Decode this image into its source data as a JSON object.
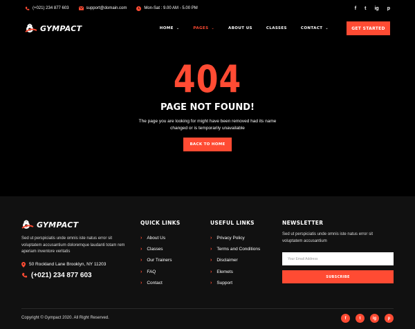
{
  "topbar": {
    "phone": "(+021) 234 877 603",
    "email": "support@domain.com",
    "hours": "Mon-Sat : 9.00 AM - 5.00 PM",
    "socials": [
      "f",
      "t",
      "ig",
      "p"
    ]
  },
  "brand": {
    "name": "GYMPACT",
    "accent_color": "#ff4b33"
  },
  "nav": {
    "items": [
      {
        "label": "HOME",
        "chevron": "⌄"
      },
      {
        "label": "PAGES",
        "chevron": "⌄"
      },
      {
        "label": "ABOUT US"
      },
      {
        "label": "CLASSES"
      },
      {
        "label": "CONTACT",
        "chevron": "⌄"
      }
    ],
    "cta": "GET STARTED"
  },
  "error": {
    "code": "404",
    "title": "PAGE NOT FOUND!",
    "message": "The page you are looking for might have been removed had its name changed or is temporarily unavailable",
    "button": "BACK TO HOME"
  },
  "footer": {
    "about": {
      "description": "Sed ut perspiciatis unde omnis iste natus error sit voluptatem accusantium doloremque laudanti totam rem aperiam inventore veritatis",
      "address": "50 Rockland Lane Brooklyn, NY 11203",
      "phone": "(+021) 234 877 603"
    },
    "quick_links": {
      "title": "QUICK LINKS",
      "items": [
        "About Us",
        "Classes",
        "Our Trainers",
        "FAQ",
        "Contact"
      ]
    },
    "useful_links": {
      "title": "USEFUL LINKS",
      "items": [
        "Privacy Policy",
        "Terms and Conditions",
        "Disclaimer",
        "Elemets",
        "Support"
      ]
    },
    "newsletter": {
      "title": "NEWSLETTER",
      "description": "Sed ut perspiciatis unde omnis iste natus error sit voluptatem accusantium",
      "placeholder": "Your Email Address",
      "button": "SUBSCRIBE"
    },
    "copyright": "Copyright © Gympact 2020. All Right Reserved.",
    "socials": [
      "f",
      "t",
      "ig",
      "p"
    ]
  }
}
